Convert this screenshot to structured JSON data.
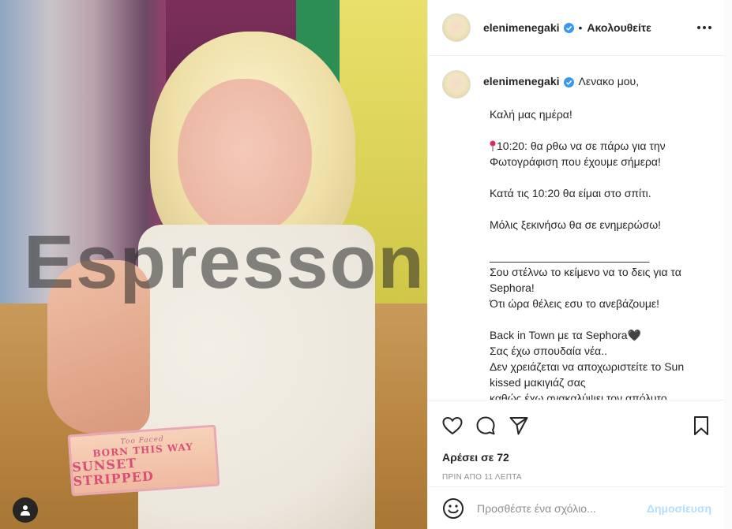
{
  "post": {
    "photo": {
      "alt_visible": false,
      "watermark": "Espressonews.gr",
      "palette_brand": "Too Faced",
      "palette_line1": "BORN THIS WAY",
      "palette_line2": "SUNSET STRIPPED"
    },
    "header": {
      "username": "elenimenegaki",
      "separator": "•",
      "follow_label": "Ακολουθείτε"
    },
    "caption": {
      "username": "elenimenegaki",
      "first_line": "Λενακο μου,",
      "paragraphs": [
        "Καλή μας ημέρα!",
        "10:20: θα ρθω να σε πάρω για την Φωτογράφιση που έχουμε σήμερα!",
        "Κατά τις 10:20 θα είμαι στο σπίτι.",
        "Μόλις ξεκινήσω θα σε ενημερώσω!",
        "__________________________",
        "Σου στέλνω το κείμενο να το δεις για τα Sephora!",
        "Ότι ώρα θέλεις εσυ το ανεβάζουμε!",
        "Back in Town με τα Sephora🖤",
        "Σας έχω σπουδαία νέα..",
        "Δεν χρειάζεται να αποχωριστείτε το Sun kissed μακιγιάζ σας",
        "καθώς έχω ανακαλύψει τον απόλυτο"
      ]
    },
    "likes_label": "Αρέσει σε 72",
    "time_label": "ΠΡΙΝ ΑΠΟ 11 ΛΕΠΤΑ",
    "add_comment": {
      "placeholder": "Προσθέστε ένα σχόλιο...",
      "post_label": "Δημοσίευση"
    }
  },
  "colors": {
    "verified": "#3897f0",
    "post_button_disabled": "#b2dffc",
    "muted_text": "#8e8e8e"
  }
}
